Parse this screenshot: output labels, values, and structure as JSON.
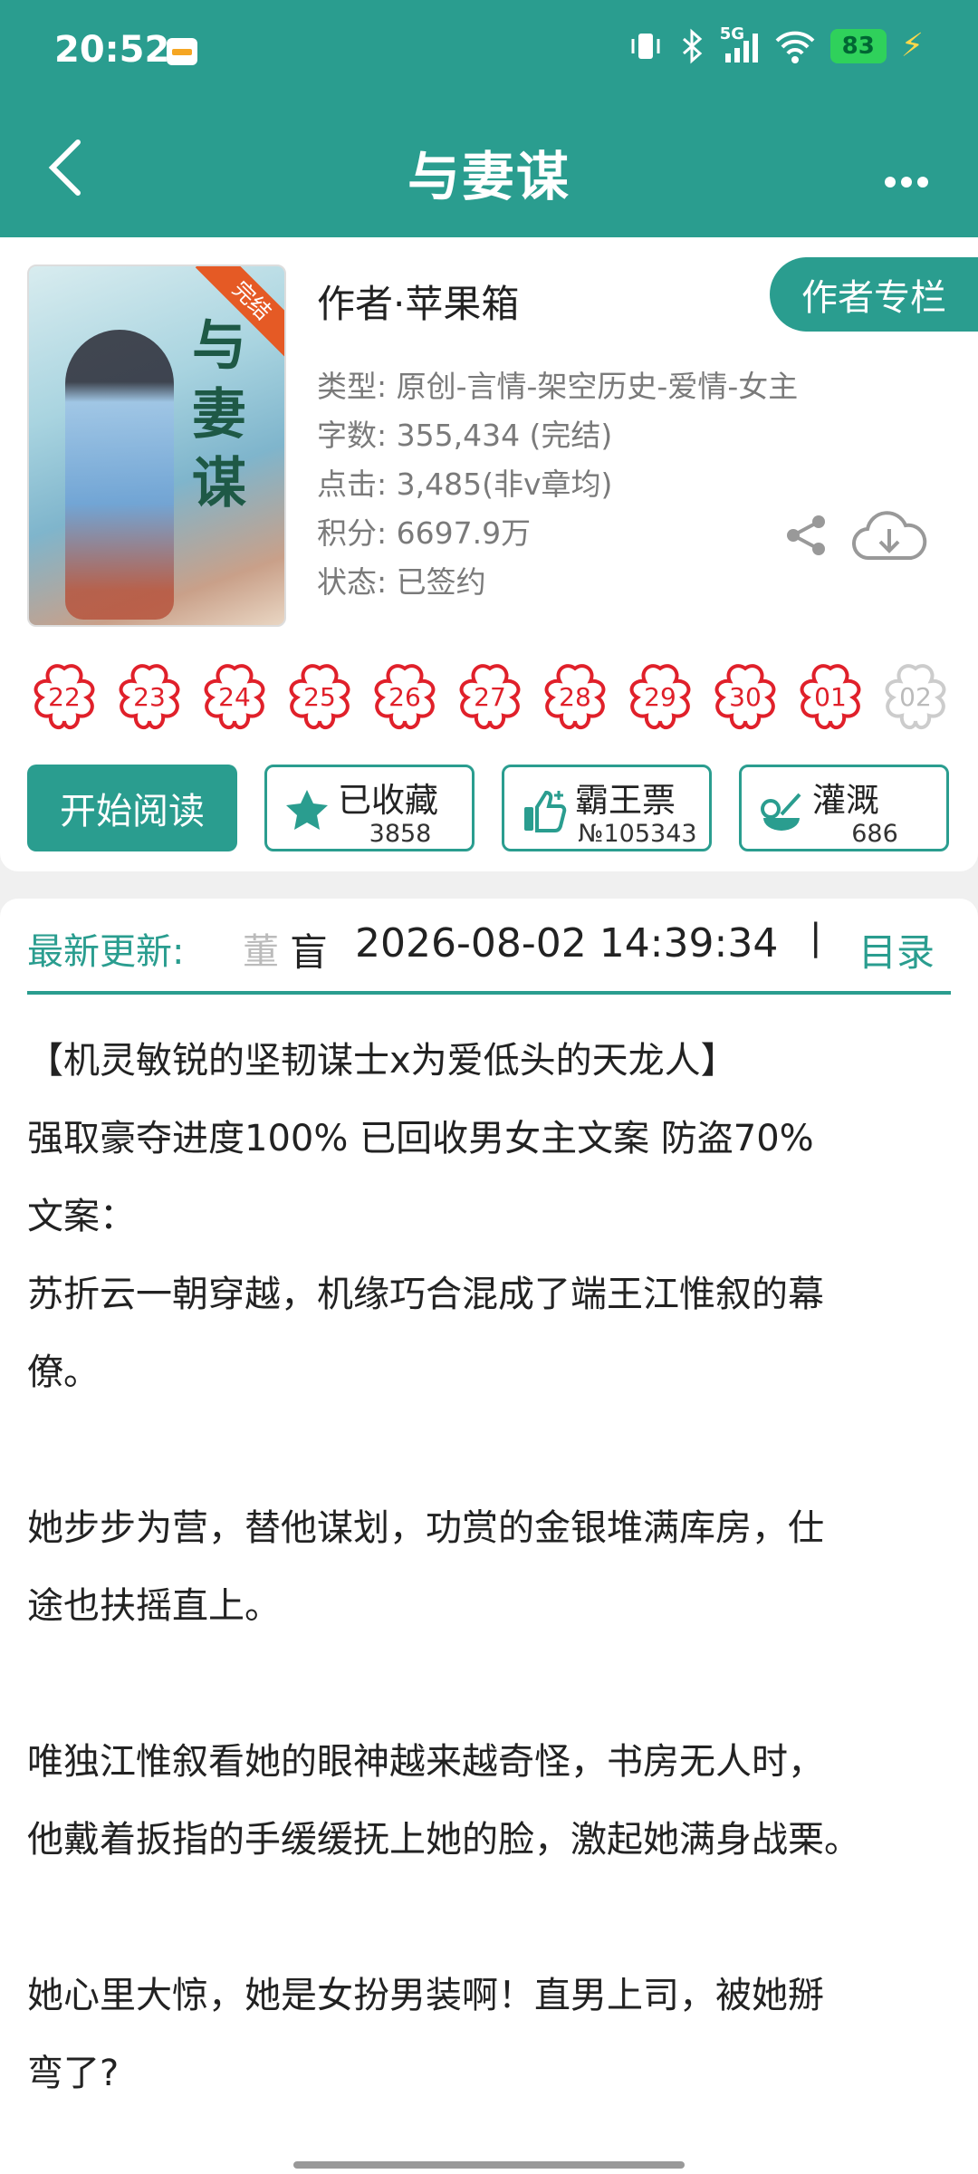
{
  "status_bar": {
    "time": "20:52",
    "network": "5G",
    "battery": "83"
  },
  "header": {
    "title": "与妻谋",
    "back_icon": "chevron-left-icon",
    "more_icon": "more-horizontal-icon"
  },
  "book": {
    "cover_badge": "完结",
    "cover_title": "与妻谋",
    "author_line": "作者·苹果箱",
    "author_link": "作者专栏",
    "meta": [
      "类型: 原创-言情-架空历史-爱情-女主",
      "字数: 355,434 (完结)",
      "点击: 3,485(非v章均)",
      "积分: 6697.9万",
      "状态: 已签约"
    ]
  },
  "chapters": [
    "22",
    "23",
    "24",
    "25",
    "26",
    "27",
    "28",
    "29",
    "30",
    "01",
    "02"
  ],
  "actions": {
    "read": "开始阅读",
    "favorite": {
      "label": "已收藏",
      "count": "3858",
      "icon": "star-icon"
    },
    "vote": {
      "label": "霸王票",
      "count": "№105343",
      "icon": "thumbs-up-icon"
    },
    "water": {
      "label": "灌溉",
      "count": "686",
      "icon": "watering-can-icon"
    }
  },
  "latest_update": {
    "label": "最新更新:",
    "chapter_fragment": "董",
    "chapter_fragment2": "盲",
    "time": "2026-08-02 14:39:34",
    "separator": "|",
    "toc": "目录"
  },
  "synopsis": {
    "lines": [
      "【机灵敏锐的坚韧谋士x为爱低头的天龙人】",
      "强取豪夺进度100%  已回收男女主文案 防盗70%",
      "文案：",
      "苏折云一朝穿越，机缘巧合混成了端王江惟叙的幕",
      "僚。",
      "",
      "她步步为营，替他谋划，功赏的金银堆满库房，仕",
      "途也扶摇直上。",
      "",
      "唯独江惟叙看她的眼神越来越奇怪，书房无人时，",
      "他戴着扳指的手缓缓抚上她的脸，激起她满身战栗。",
      "",
      "她心里大惊，她是女扮男装啊！直男上司，被她掰",
      "弯了?"
    ]
  },
  "colors": {
    "primary": "#2a9d8f",
    "chapter_red": "#e0202a",
    "meta_gray": "#7a7a7a"
  }
}
